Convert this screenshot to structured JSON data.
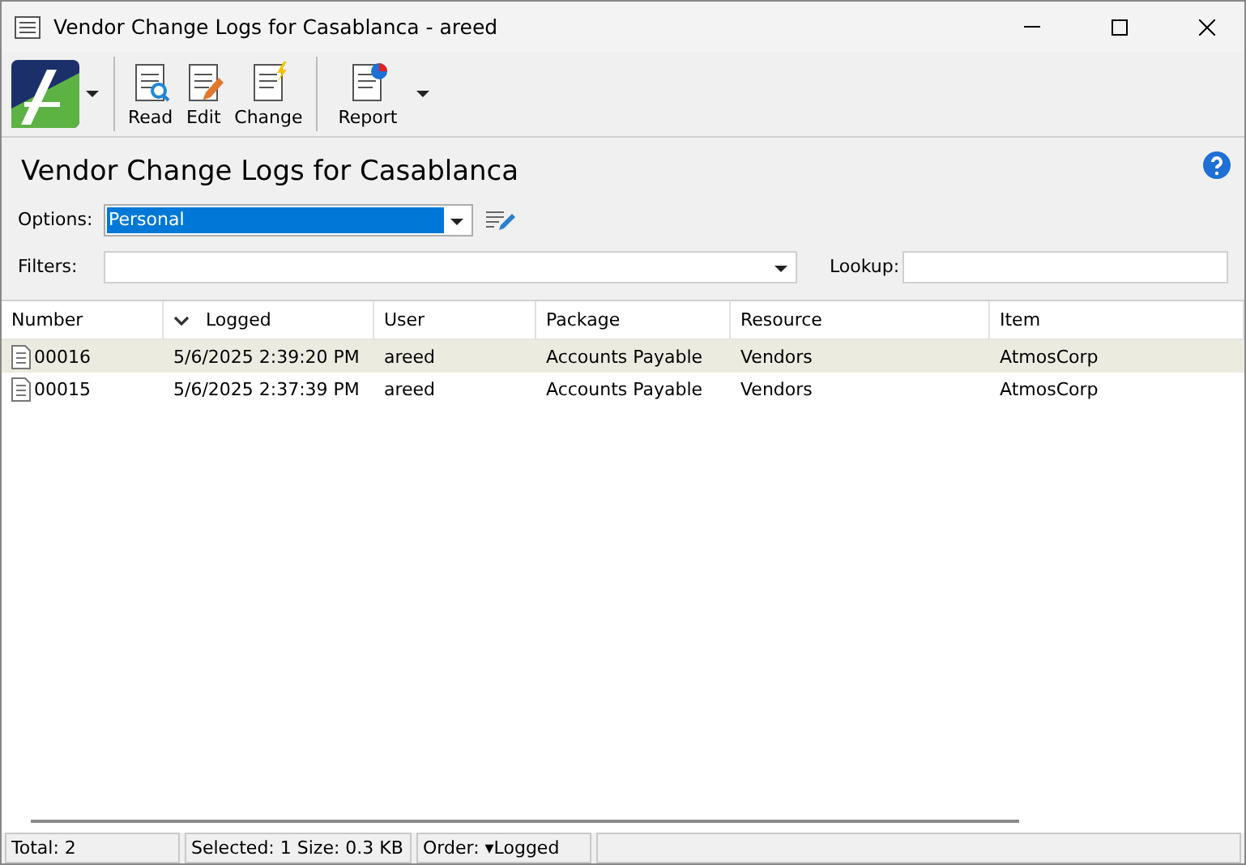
{
  "window": {
    "title": "Vendor Change Logs for Casablanca - areed"
  },
  "toolbar": [
    {
      "label": "Read",
      "kind": "read"
    },
    {
      "label": "Edit",
      "kind": "edit"
    },
    {
      "label": "Change",
      "kind": "change"
    },
    {
      "label": "Report",
      "kind": "report"
    }
  ],
  "heading": "Vendor Change Logs for Casablanca",
  "options": {
    "label": "Options:",
    "value": "Personal"
  },
  "filters": {
    "label": "Filters:"
  },
  "lookup": {
    "label": "Lookup:"
  },
  "table": {
    "columns": [
      "Number",
      "Logged",
      "User",
      "Package",
      "Resource",
      "Item"
    ],
    "rows": [
      {
        "selected": true,
        "cells": [
          "00016",
          "5/6/2025 2:39:20 PM",
          "areed",
          "Accounts Payable",
          "Vendors",
          "AtmosCorp"
        ]
      },
      {
        "selected": false,
        "cells": [
          "00015",
          "5/6/2025 2:37:39 PM",
          "areed",
          "Accounts Payable",
          "Vendors",
          "AtmosCorp"
        ]
      }
    ]
  },
  "status_bar": [
    "Total: 2",
    "Selected: 1  Size: 0.3 KB",
    "Order: ▾Logged"
  ]
}
